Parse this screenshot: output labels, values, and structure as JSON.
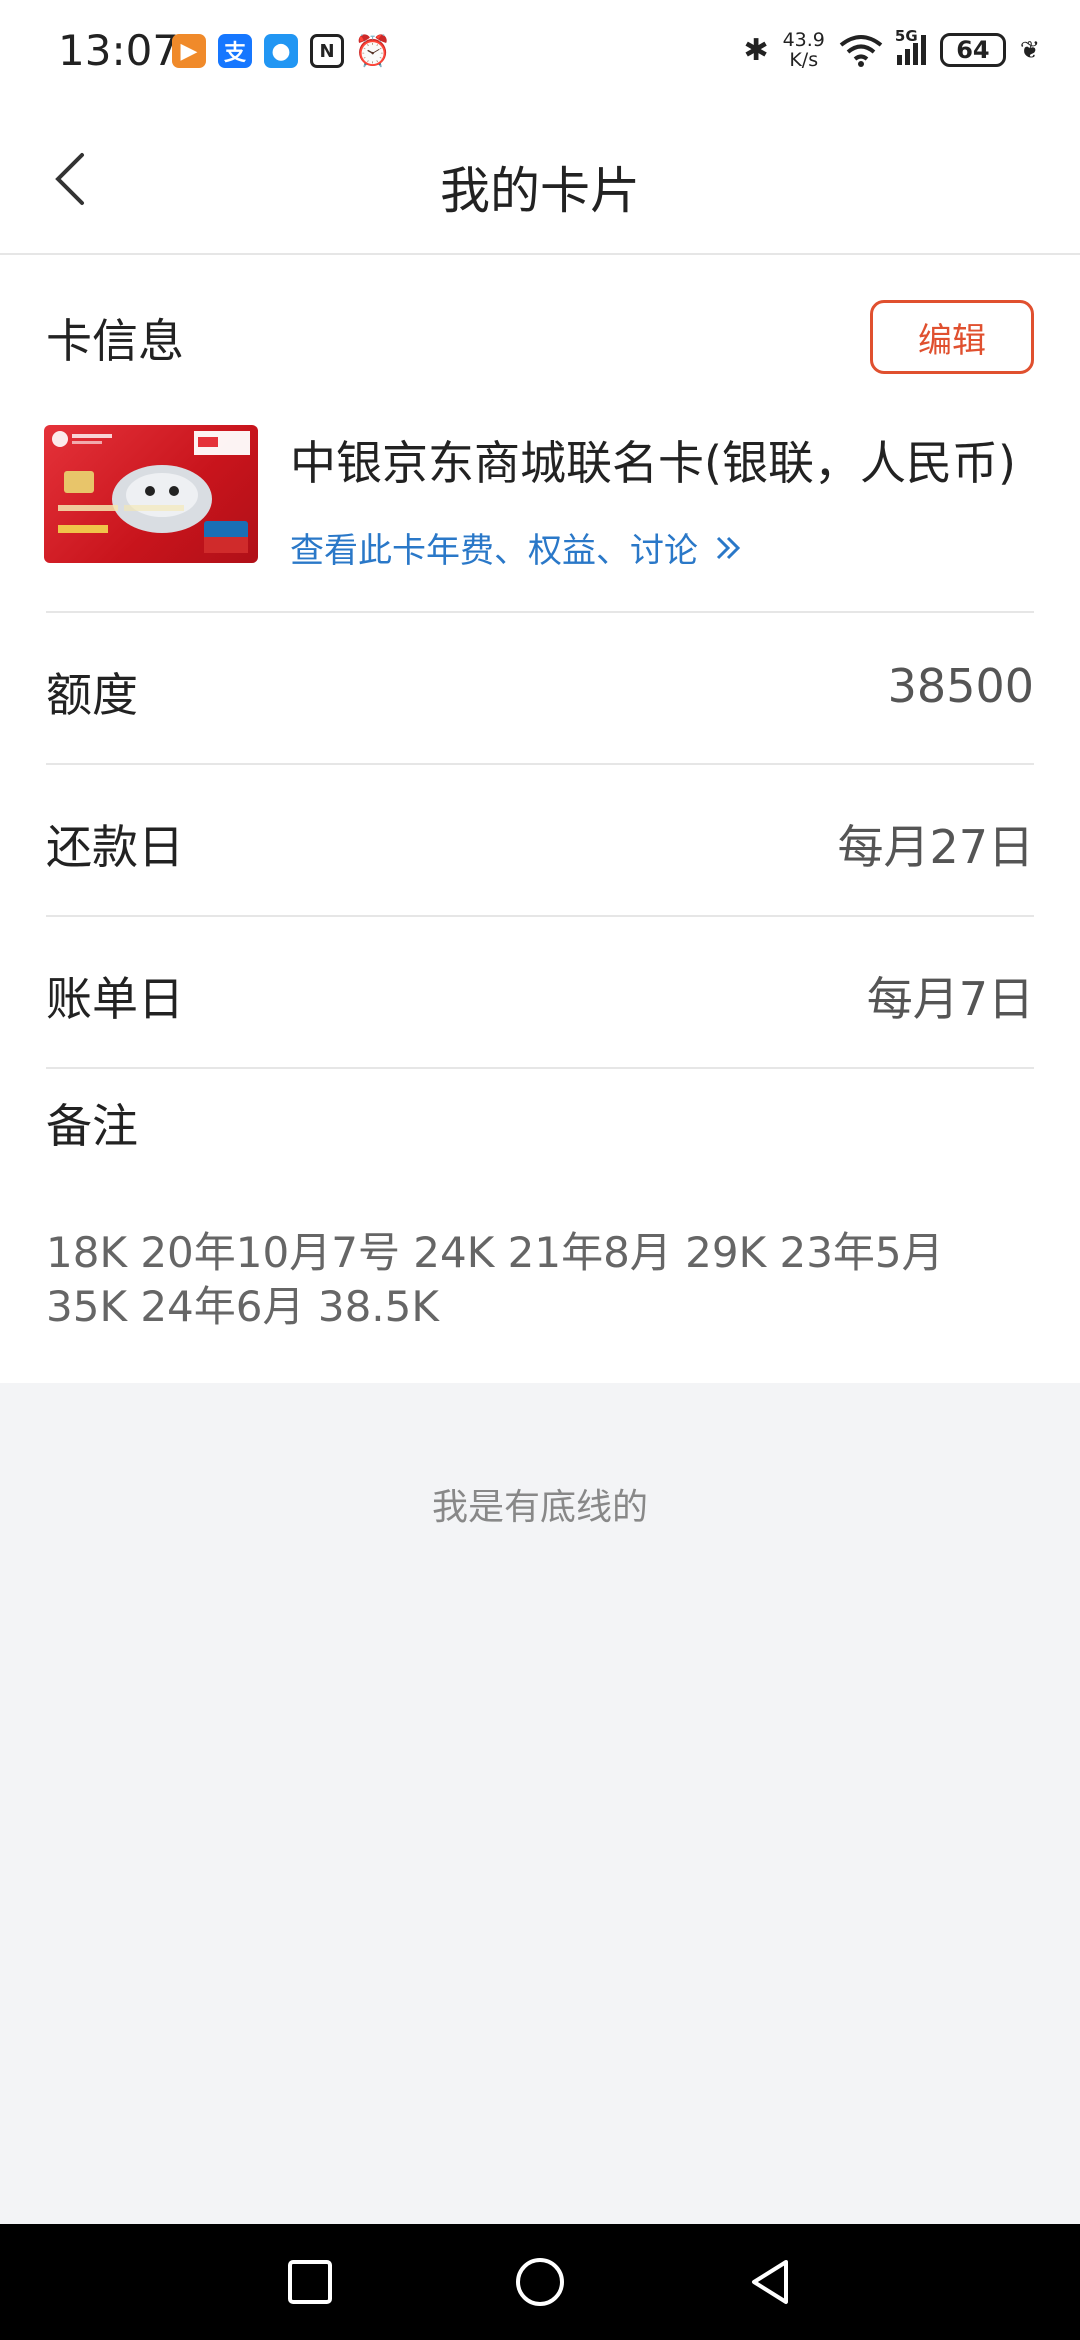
{
  "status_bar": {
    "time": "13:07",
    "net_speed_value": "43.9",
    "net_speed_unit": "K/s",
    "signal_type": "5G",
    "battery": "64"
  },
  "nav": {
    "title": "我的卡片"
  },
  "card_info": {
    "section_label": "卡信息",
    "edit_label": "编辑",
    "card_name": "中银京东商城联名卡(银联，人民币)",
    "card_link": "查看此卡年费、权益、讨论"
  },
  "details": [
    {
      "label": "额度",
      "value": "38500"
    },
    {
      "label": "还款日",
      "value": "每月27日"
    },
    {
      "label": "账单日",
      "value": "每月7日"
    }
  ],
  "notes": {
    "label": "备注",
    "line1": "18K 20年10月7号 24K 21年8月 29K 23年5月",
    "line2": "35K 24年6月 38.5K"
  },
  "footer_note": "我是有底线的",
  "colors": {
    "accent": "#e0502f",
    "link": "#2a78c8",
    "card_red": "#d01c24"
  }
}
